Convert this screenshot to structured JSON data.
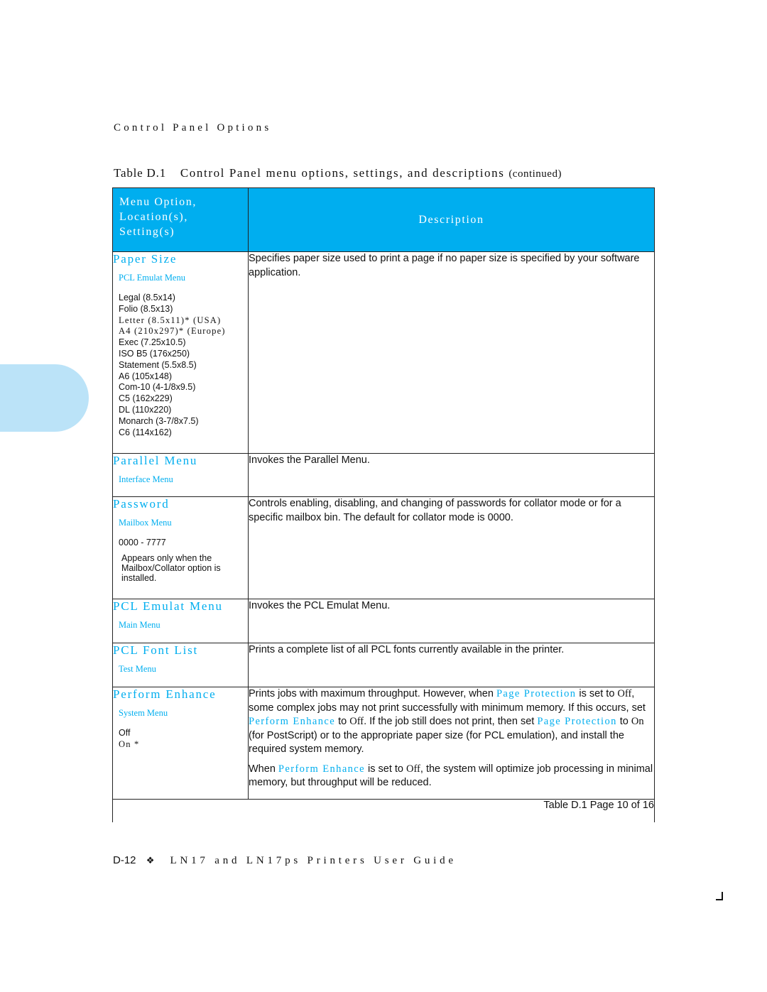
{
  "running_head": "Control Panel Options",
  "table_title": {
    "number": "Table D.1",
    "caption": "Control Panel menu options, settings, and descriptions",
    "continued": "(continued)"
  },
  "header": {
    "col1_lines": [
      "Menu Option,",
      "Location(s),",
      "Setting(s)"
    ],
    "col2": "Description"
  },
  "rows": [
    {
      "name": "Paper Size",
      "location": "PCL Emulat Menu",
      "settings": [
        "Legal (8.5x14)",
        "Folio (8.5x13)",
        "Letter (8.5x11)* (USA)",
        "A4 (210x297)* (Europe)",
        "Exec (7.25x10.5)",
        "ISO B5 (176x250)",
        "Statement (5.5x8.5)",
        "A6 (105x148)",
        "Com-10 (4-1/8x9.5)",
        "C5 (162x229)",
        "DL (110x220)",
        "Monarch (3-7/8x7.5)",
        "C6 (114x162)"
      ],
      "description": "Specifies paper size used to print a page if no paper size is specified by your software application."
    },
    {
      "name": "Parallel Menu",
      "location": "Interface Menu",
      "description": "Invokes the Parallel Menu."
    },
    {
      "name": "Password",
      "location": "Mailbox Menu",
      "settings": [
        "0000 - 7777"
      ],
      "note": "Appears only when the Mailbox/Collator option is installed.",
      "description": "Controls enabling, disabling, and changing of passwords for collator mode or for a specific mailbox bin. The default for collator mode is 0000."
    },
    {
      "name": "PCL Emulat Menu",
      "location": "Main Menu",
      "description": "Invokes the PCL Emulat Menu."
    },
    {
      "name": "PCL Font List",
      "location": "Test Menu",
      "description": "Prints a complete list of all PCL fonts currently available in the printer."
    },
    {
      "name": "Perform Enhance",
      "location": "System Menu",
      "settings": [
        "Off",
        "On *"
      ],
      "description_p1": {
        "t1": "Prints jobs with maximum throughput. However, when ",
        "ref1": "Page Protection",
        "t2": " is set to ",
        "val1": "Off",
        "t3": ", some complex jobs may not print successfully with minimum memory. If this occurs, set ",
        "ref2": "Perform Enhance",
        "t4": " to ",
        "val2": "Off",
        "t5": ". If the job still does not print, then set ",
        "ref3": "Page Protection",
        "t6": " to ",
        "val3": "On",
        "t7": " (for PostScript) or to the appropriate paper size (for PCL emulation), and install the required system memory."
      },
      "description_p2": {
        "t1": "When ",
        "ref1": "Perform Enhance",
        "t2": " is set to ",
        "val1": "Off",
        "t3": ", the system will optimize job processing in minimal memory, but throughput will be reduced."
      }
    }
  ],
  "page_indicator": "Table D.1  Page 10 of 16",
  "footer": {
    "page_number": "D-12",
    "ornament": "❖",
    "book_title": "LN17 and LN17ps Printers User Guide"
  }
}
